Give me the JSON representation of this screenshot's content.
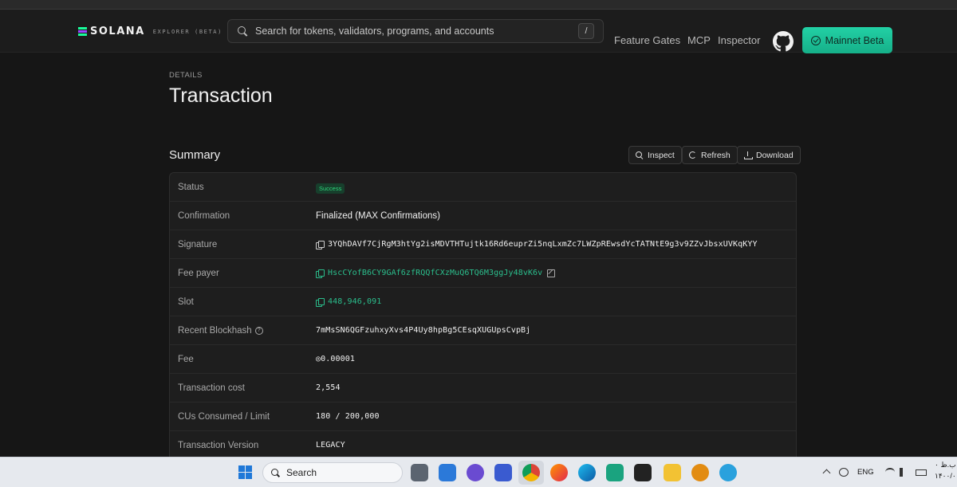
{
  "navbar": {
    "logo_text": "SOLANA",
    "logo_sub": "EXPLORER (BETA)",
    "search_placeholder": "Search for tokens, validators, programs, and accounts",
    "search_shortcut": "/",
    "links": [
      "Feature Gates",
      "MCP",
      "Inspector"
    ],
    "network_label": "Mainnet Beta",
    "accent_color": "#1fc89e"
  },
  "page": {
    "eyebrow": "DETAILS",
    "title": "Transaction"
  },
  "summary": {
    "title": "Summary",
    "actions": {
      "inspect": "Inspect",
      "refresh": "Refresh",
      "download": "Download"
    },
    "rows": [
      {
        "label": "Status",
        "value": "Success"
      },
      {
        "label": "Confirmation",
        "value": "Finalized (MAX Confirmations)"
      },
      {
        "label": "Signature",
        "value": "3YQhDAVf7CjRgM3htYg2isMDVTHTujtk16Rd6euprZi5nqLxmZc7LWZpREwsdYcTATNtE9g3v9ZZvJbsxUVKqKYY"
      },
      {
        "label": "Fee payer",
        "value": "HscCYofB6CY9GAf6zfRQQfCXzMuQ6TQ6M3ggJy48vK6v"
      },
      {
        "label": "Slot",
        "value": "448,946,091"
      },
      {
        "label": "Recent Blockhash",
        "value": "7mMsSN6QGFzuhxyXvs4P4Uy8hpBg5CEsqXUGUpsCvpBj"
      },
      {
        "label": "Fee",
        "value": "◎0.00001"
      },
      {
        "label": "Transaction cost",
        "value": "2,554"
      },
      {
        "label": "CUs Consumed / Limit",
        "value": "180 / 200,000"
      },
      {
        "label": "Transaction Version",
        "value": "LEGACY"
      }
    ]
  },
  "taskbar": {
    "search_label": "Search",
    "language": "ENG",
    "clock_line1": "ب.ظ ۰",
    "clock_line2": "۱۴۰۰/۰"
  }
}
